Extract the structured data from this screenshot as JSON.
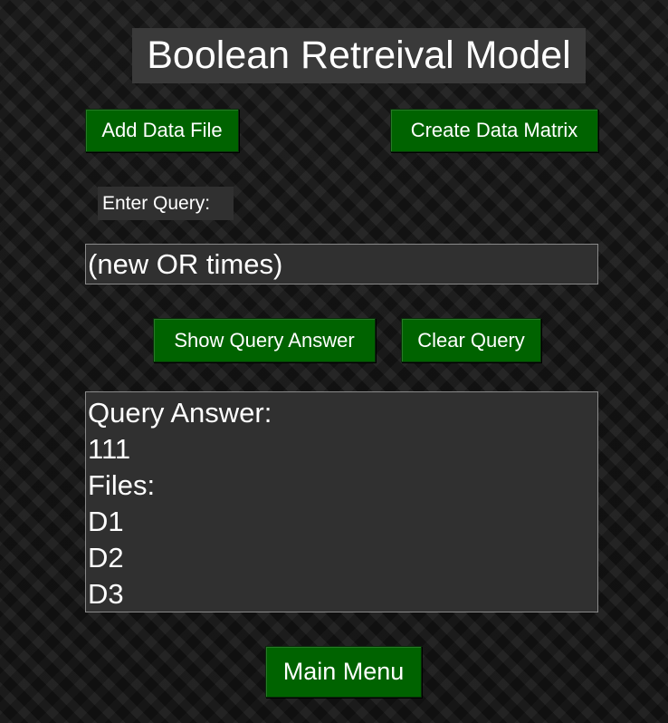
{
  "app": {
    "title": "Boolean Retreival Model"
  },
  "toolbar": {
    "add_file_label": "Add Data File",
    "create_matrix_label": "Create Data Matrix"
  },
  "query": {
    "label": "Enter Query:",
    "value": "(new OR times)"
  },
  "actions": {
    "show_answer_label": "Show Query Answer",
    "clear_query_label": "Clear Query"
  },
  "answer": {
    "lines": [
      "Query Answer:",
      "111",
      "Files:",
      "D1",
      "D2",
      "D3"
    ]
  },
  "footer": {
    "main_menu_label": "Main Menu"
  },
  "colors": {
    "button_green": "#006300",
    "panel_gray": "#303030",
    "title_gray": "#3a3a3a",
    "text": "#ffffff"
  }
}
